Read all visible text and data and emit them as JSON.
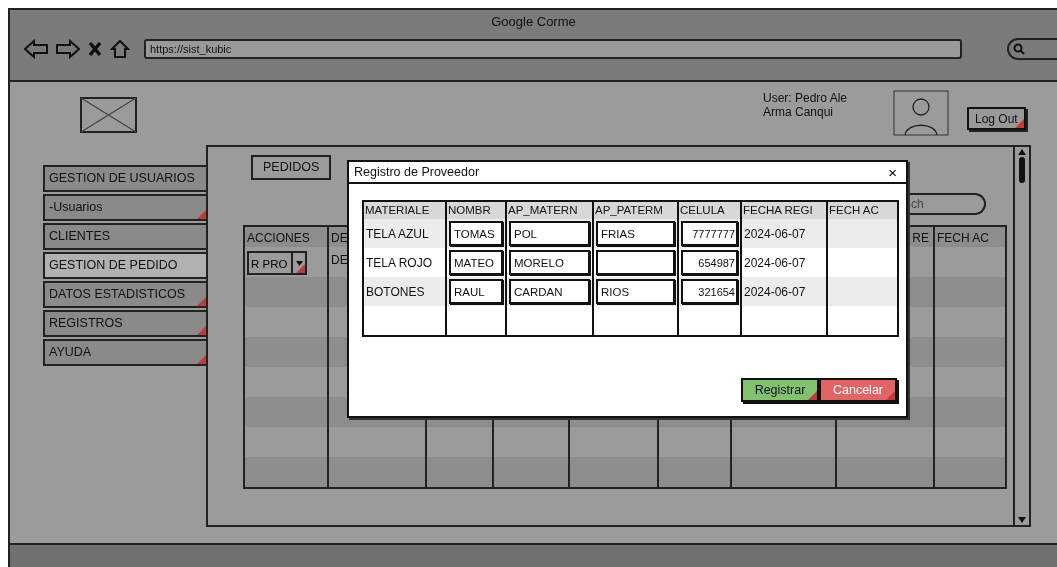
{
  "browser": {
    "title": "Google Corme",
    "url": "https://sist_kubic"
  },
  "header": {
    "user_lines": [
      "User: Pedro Ale",
      "Arma Canqui"
    ],
    "logout": {
      "label": "Log Out",
      "linked": true
    }
  },
  "sidebar": {
    "items": [
      {
        "label": "GESTION DE USUARIOS",
        "selected": false,
        "linked": false
      },
      {
        "label": "-Usuarios",
        "selected": false,
        "linked": true
      },
      {
        "label": "CLIENTES",
        "selected": false,
        "linked": false
      },
      {
        "label": "GESTION DE PEDIDO",
        "selected": true,
        "linked": false
      },
      {
        "label": "DATOS ESTADISTICOS",
        "selected": false,
        "linked": true
      },
      {
        "label": "REGISTROS",
        "selected": false,
        "linked": true
      },
      {
        "label": "AYUDA",
        "selected": false,
        "linked": true
      }
    ]
  },
  "tabs": [
    {
      "label": "PEDIDOS",
      "selected": false
    }
  ],
  "search": {
    "placeholder": "ch"
  },
  "orders_table": {
    "columns": [
      {
        "label": "ACCIONES"
      },
      {
        "label": "DE"
      },
      {},
      {},
      {},
      {},
      {},
      {
        "label": "RE"
      },
      {
        "label": "FECH AC"
      }
    ],
    "rows": [
      {
        "action": {
          "value": "R PRO",
          "linked": true
        },
        "column_2": "DE"
      }
    ]
  },
  "dialog": {
    "title": "Registro de Proveedor",
    "close": "×",
    "columns": [
      "MATERIALE",
      "NOMBR",
      "AP_MATERN",
      "AP_PATERM",
      "CELULA",
      "FECHA REGI",
      "FECH AC"
    ],
    "rows": [
      {
        "material": "TELA AZUL",
        "nombre": "TOMAS",
        "ap_matern": "POL",
        "ap_paterm": "FRIAS",
        "celula": "7777777",
        "fecha": "2024-06-07"
      },
      {
        "material": "TELA ROJO",
        "nombre": "MATEO",
        "ap_matern": "MORELO",
        "celula": "654987",
        "fecha": "2024-06-07"
      },
      {
        "material": "BOTONES",
        "nombre": "RAUL",
        "ap_matern": "CARDAN",
        "ap_paterm": "RIOS",
        "celula": "321654",
        "fecha": "2024-06-07"
      }
    ],
    "buttons": [
      {
        "label": "Registrar",
        "kind": "primary",
        "linked": true
      },
      {
        "label": "Cancelar",
        "kind": "danger",
        "linked": true
      }
    ]
  }
}
